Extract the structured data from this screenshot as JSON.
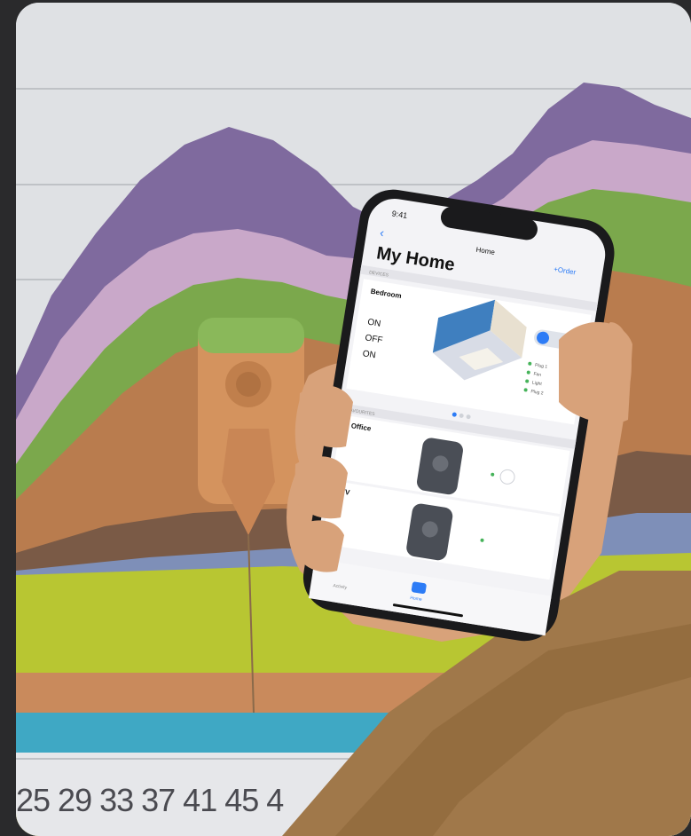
{
  "axis": {
    "tick_labels": "25 29 33 37 41 45 4"
  },
  "phone": {
    "time": "9:41",
    "nav_title": "Home",
    "nav_action": "+Order",
    "page_title": "My Home",
    "section_devices": "DEVICES",
    "room_name": "Bedroom",
    "status_on_1": "ON",
    "status_off": "OFF",
    "status_on_2": "ON",
    "section_favourites": "FAVOURITES",
    "fav_1": "Office",
    "fav_2": "TV",
    "tab_activity": "Activity",
    "tab_home": "Home",
    "legend": [
      "Plug 1",
      "Fan",
      "Light",
      "Plug 2"
    ]
  },
  "colors": {
    "purple": "#7f6a9e",
    "lilac": "#c9a8c9",
    "green": "#7ba84c",
    "brown": "#b97c4e",
    "dark_brown": "#7a5a46",
    "blue": "#7e8fb8",
    "lime": "#b8c632",
    "teal": "#3fa8c4",
    "sleeve": "#a0784a"
  }
}
